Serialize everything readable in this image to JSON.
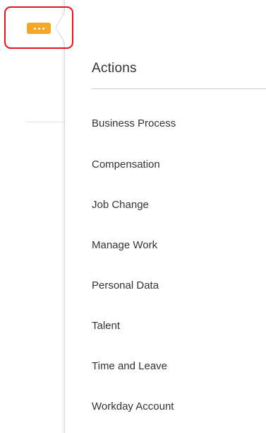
{
  "related_actions": {
    "button_icon": "ellipsis-icon",
    "button_color": "#f5a623",
    "highlight_color": "#e3121b"
  },
  "popup": {
    "title": "Actions",
    "items": [
      {
        "label": "Business Process"
      },
      {
        "label": "Compensation"
      },
      {
        "label": "Job Change"
      },
      {
        "label": "Manage Work"
      },
      {
        "label": "Personal Data"
      },
      {
        "label": "Talent"
      },
      {
        "label": "Time and Leave"
      },
      {
        "label": "Workday Account"
      }
    ]
  }
}
